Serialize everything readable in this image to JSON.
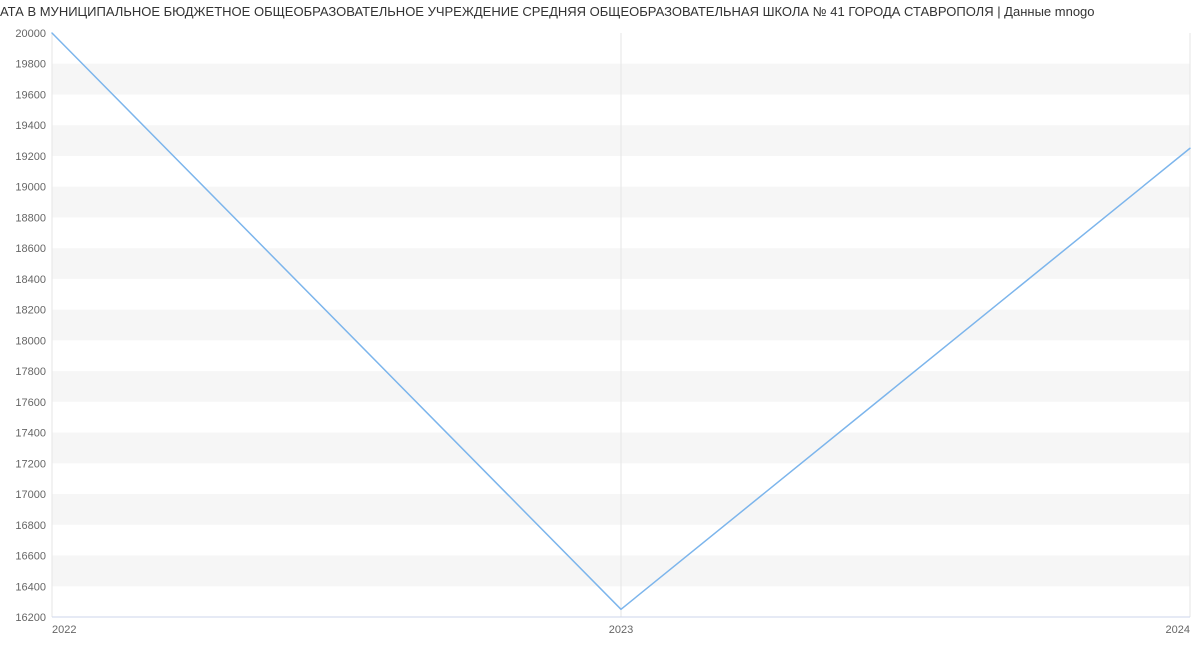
{
  "title": "АТА В МУНИЦИПАЛЬНОЕ БЮДЖЕТНОЕ ОБЩЕОБРАЗОВАТЕЛЬНОЕ УЧРЕЖДЕНИЕ СРЕДНЯЯ ОБЩЕОБРАЗОВАТЕЛЬНАЯ ШКОЛА № 41 ГОРОДА СТАВРОПОЛЯ | Данные mnogo",
  "chart_data": {
    "type": "line",
    "x": [
      2022,
      2023,
      2024
    ],
    "y": [
      20000,
      16250,
      19250
    ],
    "x_ticks": [
      "2022",
      "2023",
      "2024"
    ],
    "y_ticks": [
      16200,
      16400,
      16600,
      16800,
      17000,
      17200,
      17400,
      17600,
      17800,
      18000,
      18200,
      18400,
      18600,
      18800,
      19000,
      19200,
      19400,
      19600,
      19800,
      20000
    ],
    "title": "",
    "xlabel": "",
    "ylabel": "",
    "ylim": [
      16200,
      20000
    ],
    "xlim": [
      2022,
      2024
    ],
    "line_color": "#7cb5ec"
  }
}
